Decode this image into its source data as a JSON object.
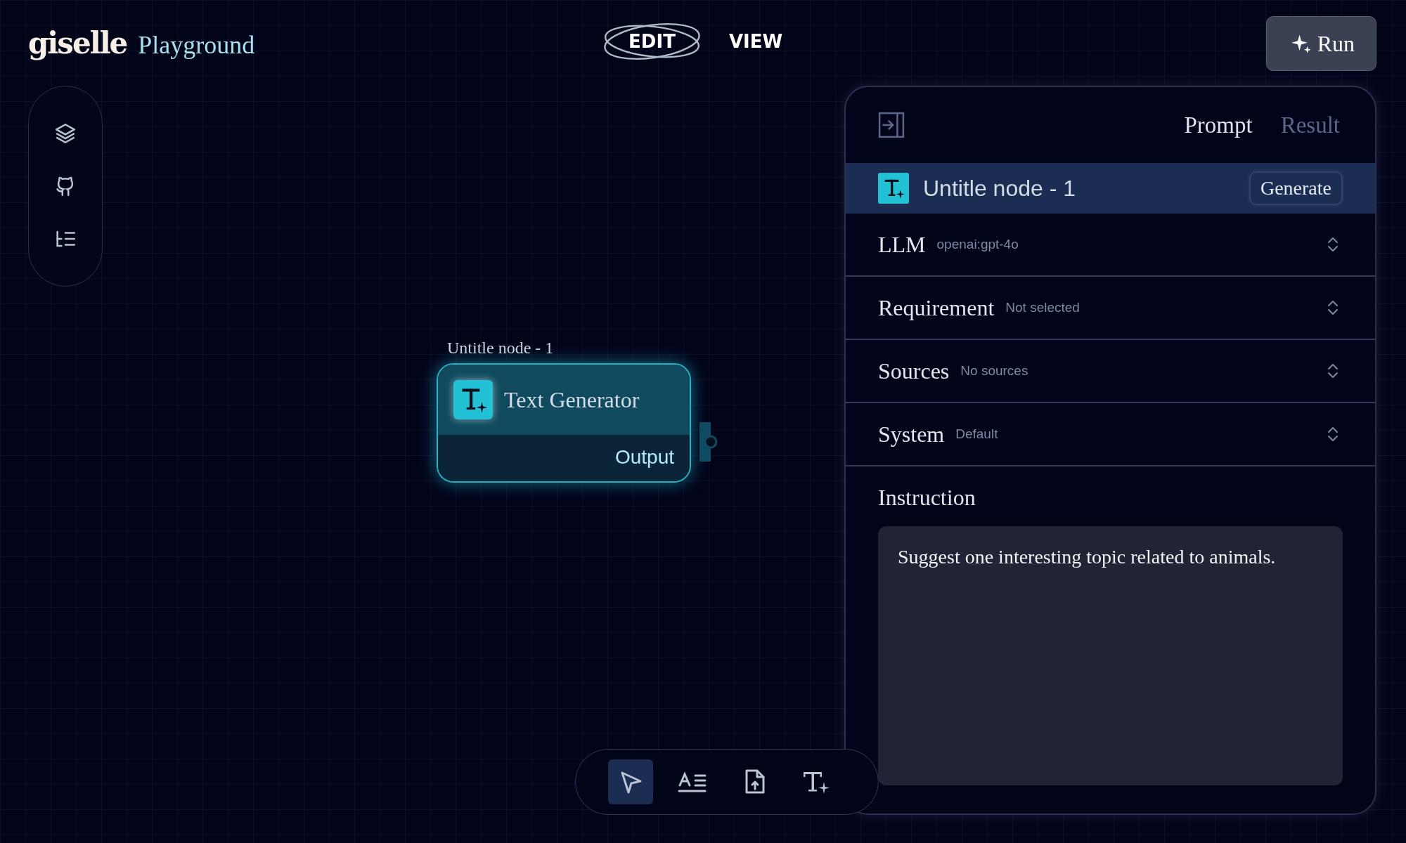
{
  "logo": {
    "wordmark": "giselle",
    "product": "Playground"
  },
  "mode_tabs": [
    {
      "label": "EDIT",
      "selected": true
    },
    {
      "label": "VIEW",
      "selected": false
    }
  ],
  "run_button": {
    "label": "Run"
  },
  "node": {
    "title": "Untitle node - 1",
    "name": "Text Generator",
    "output": "Output",
    "selected": true
  },
  "panel": {
    "tabs": [
      {
        "label": "Prompt",
        "selected": true
      },
      {
        "label": "Result",
        "selected": false
      }
    ],
    "node_title": "Untitle node - 1",
    "generate_button": "Generate",
    "settings": [
      {
        "label": "LLM",
        "value": "openai:gpt-4o"
      },
      {
        "label": "Requirement",
        "value": "Not selected"
      },
      {
        "label": "Sources",
        "value": "No sources"
      },
      {
        "label": "System",
        "value": "Default"
      }
    ],
    "instruction": {
      "label": "Instruction",
      "value": "Suggest one interesting topic related to animals."
    }
  },
  "toolbar": [
    {
      "kind": "select",
      "selected": true
    },
    {
      "kind": "text",
      "selected": false
    },
    {
      "kind": "upload",
      "selected": false
    },
    {
      "kind": "generator",
      "selected": false
    }
  ]
}
